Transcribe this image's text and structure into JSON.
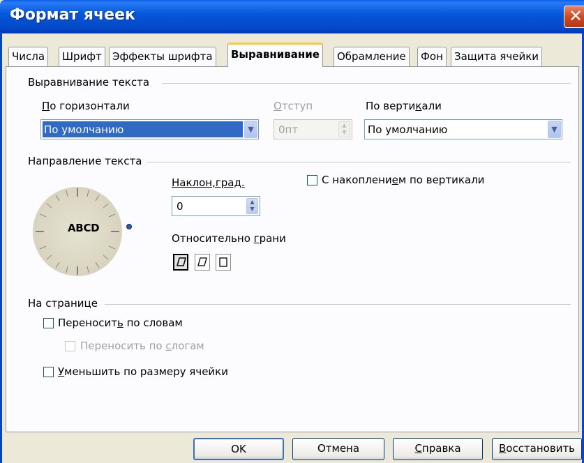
{
  "window": {
    "title": "Формат ячеек",
    "close_glyph": "✕"
  },
  "tabs": [
    {
      "label": "Числа"
    },
    {
      "label": "Шрифт"
    },
    {
      "label": "Эффекты шрифта"
    },
    {
      "label": "Выравнивание",
      "active": true
    },
    {
      "label": "Обрамление"
    },
    {
      "label": "Фон"
    },
    {
      "label": "Защита ячейки"
    }
  ],
  "text_alignment": {
    "group_label": "Выравнивание текста",
    "horizontal": {
      "label_pre": "",
      "label_u": "П",
      "label_post": "о горизонтали",
      "value": "По умолчанию"
    },
    "indent": {
      "label_u": "О",
      "label_post": "тступ",
      "value": "0пт",
      "disabled": true
    },
    "vertical": {
      "label_pre": "По верти",
      "label_u": "к",
      "label_post": "али",
      "value": "По умолчанию"
    }
  },
  "text_direction": {
    "group_label": "Направление текста",
    "dial_text": "ABCD",
    "angle_label": "Наклон,град.",
    "angle_value": "0",
    "stacked_label_pre": "С накоплени",
    "stacked_label_u": "е",
    "stacked_label_post": "м по вертикали",
    "stacked_checked": false,
    "reference_label_pre": "Относительно ",
    "reference_label_u": "г",
    "reference_label_post": "рани"
  },
  "on_page": {
    "group_label": "На странице",
    "wrap_label_pre": "Переносит",
    "wrap_label_u": "ь",
    "wrap_label_post": " по словам",
    "wrap_checked": false,
    "hyphen_label_pre": "Переносить по ",
    "hyphen_label_u": "с",
    "hyphen_label_post": "логам",
    "hyphen_disabled": true,
    "shrink_label_u": "У",
    "shrink_label_post": "меньшить по размеру ячейки",
    "shrink_checked": false
  },
  "buttons": {
    "ok": "OK",
    "cancel": "Отмена",
    "help_u": "С",
    "help_post": "правка",
    "reset_u": "В",
    "reset_post": "осстановить"
  },
  "colors": {
    "titlebar": "#0348C8",
    "selection": "#316AC5",
    "active_tab_accent": "#FFC83C"
  }
}
